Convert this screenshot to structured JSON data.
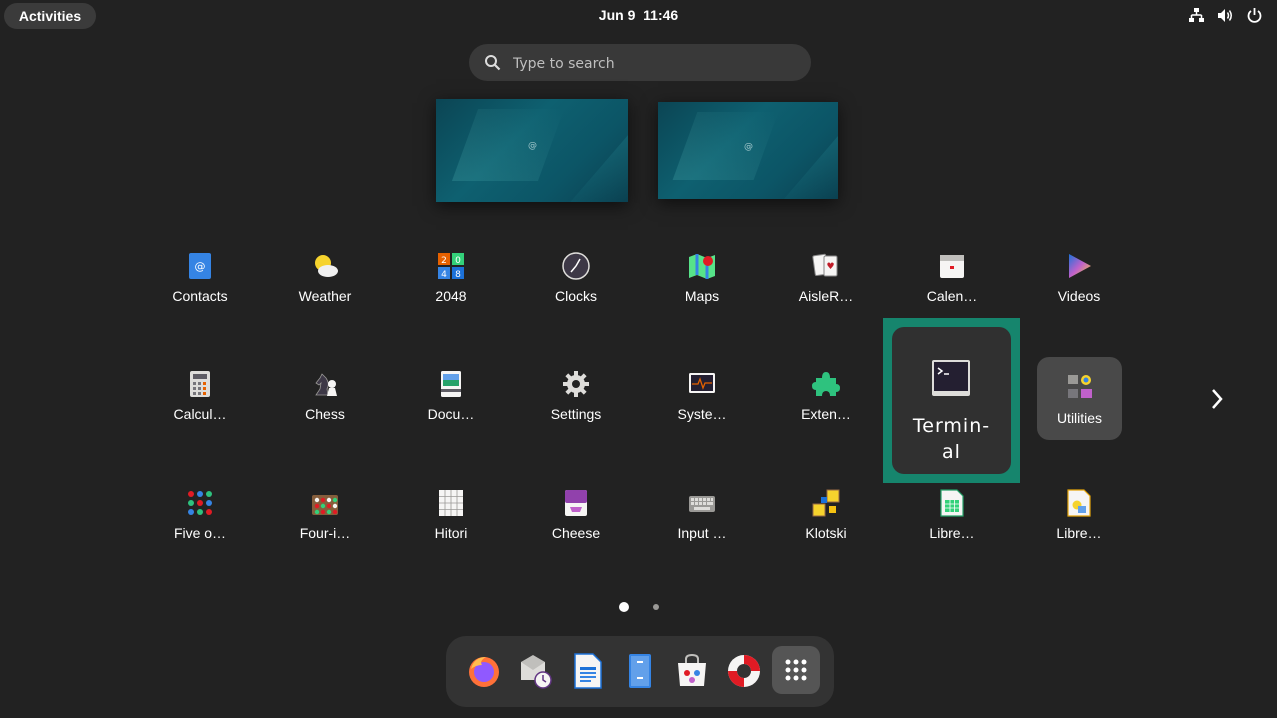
{
  "topbar": {
    "activities_label": "Activities",
    "date": "Jun 9",
    "time": "11:46",
    "tray_icons": [
      "network-icon",
      "volume-icon",
      "power-icon"
    ]
  },
  "search": {
    "placeholder": "Type to search"
  },
  "app_grid": {
    "rows": [
      [
        "Contacts",
        "Weather",
        "2048",
        "Clocks",
        "Maps",
        "AisleR…",
        "Calen…",
        "Videos"
      ],
      [
        "Calcul…",
        "Chess",
        "Docu…",
        "Settings",
        "Syste…",
        "Exten…",
        "Termin-\nal",
        "Utilities"
      ],
      [
        "Five o…",
        "Four-i…",
        "Hitori",
        "Cheese",
        "Input …",
        "Klotski",
        "Libre…",
        "Libre…"
      ]
    ],
    "focused_app": "Termin-\nal",
    "folder": "Utilities",
    "page_count": 2,
    "current_page": 1
  },
  "dash": {
    "items": [
      "firefox-icon",
      "evolution-mail-icon",
      "libreoffice-writer-icon",
      "file-manager-icon",
      "software-store-icon",
      "help-icon",
      "show-apps-grid-icon"
    ]
  },
  "colors": {
    "background": "#222222",
    "focus_highlight": "#16856d",
    "dash_bg": "#333333",
    "search_bg": "#393939"
  }
}
